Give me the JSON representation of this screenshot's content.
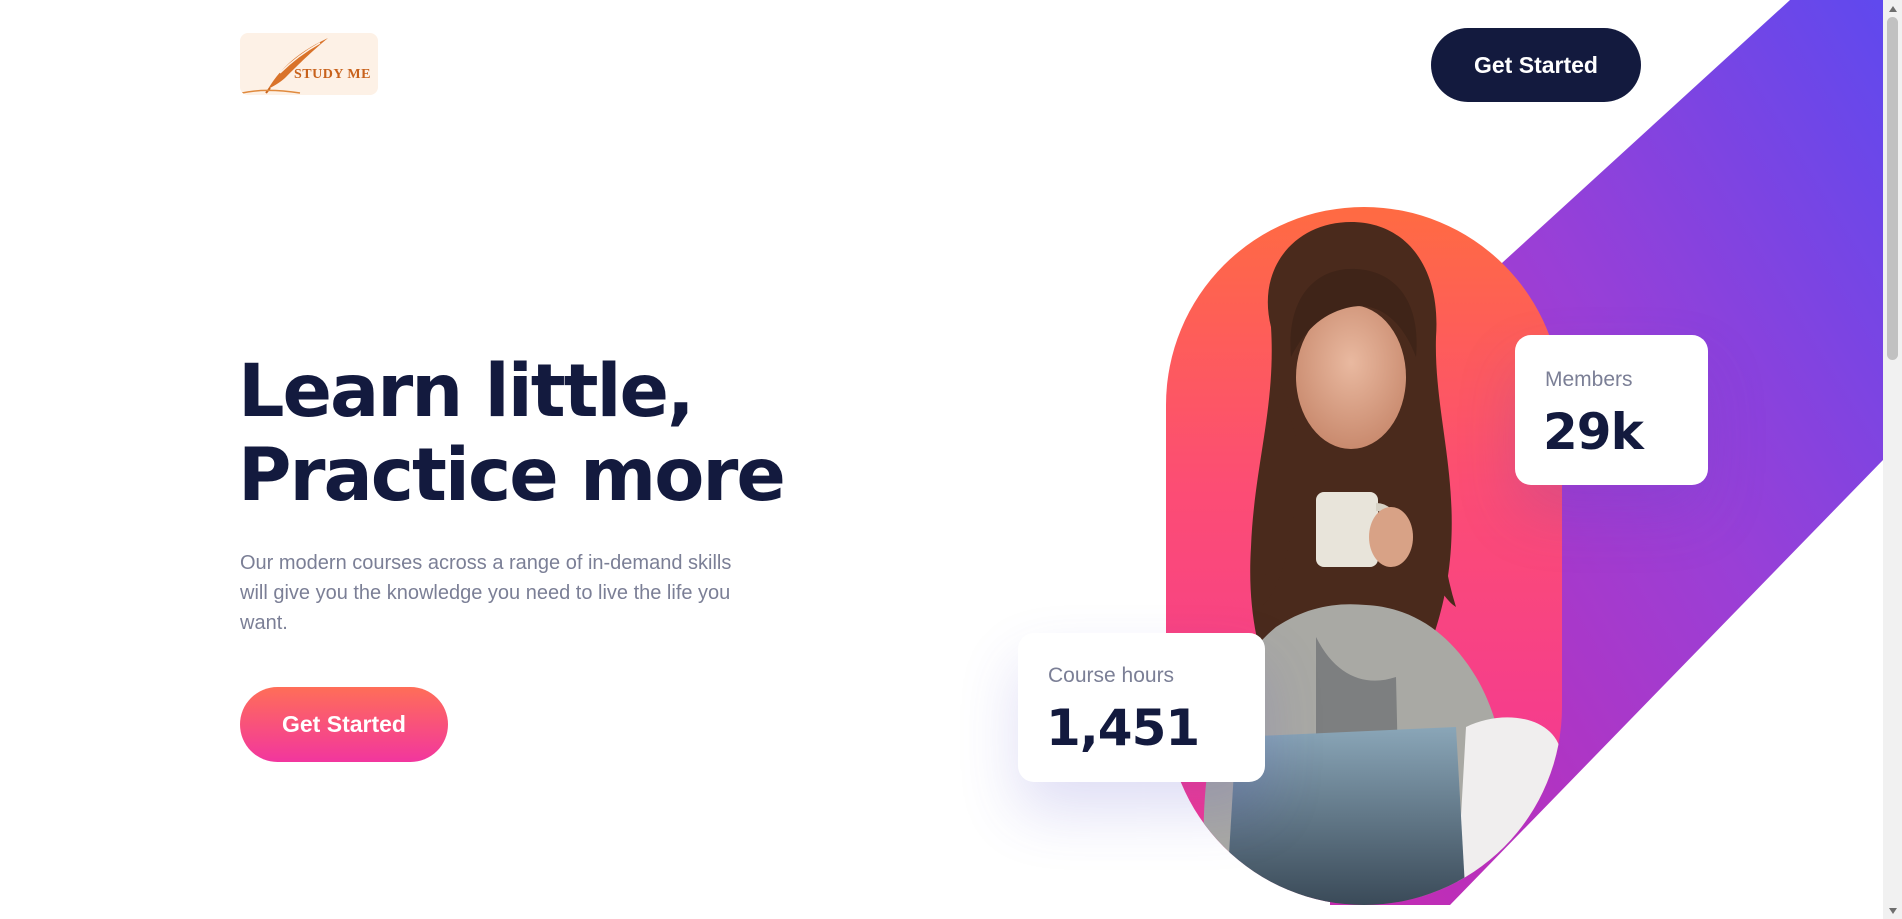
{
  "header": {
    "logo_text": "STUDY ME",
    "cta_label": "Get Started"
  },
  "hero": {
    "title_line1": "Learn little,",
    "title_line2": "Practice more",
    "description": "Our modern courses across a range of in-demand skills will give you the knowledge you need to live the life you want.",
    "cta_label": "Get Started"
  },
  "stats": {
    "members": {
      "label": "Members",
      "value": "29k"
    },
    "course_hours": {
      "label": "Course hours",
      "value": "1,451"
    }
  },
  "icons": {
    "logo": "quill-pen-icon",
    "scroll_up": "triangle-up-icon",
    "scroll_down": "triangle-down-icon"
  },
  "colors": {
    "navy": "#131a3e",
    "accent_orange": "#ff6e58",
    "accent_pink": "#f2369e",
    "stripe_purple": "#6747ec",
    "muted_text": "#7b7f96"
  }
}
